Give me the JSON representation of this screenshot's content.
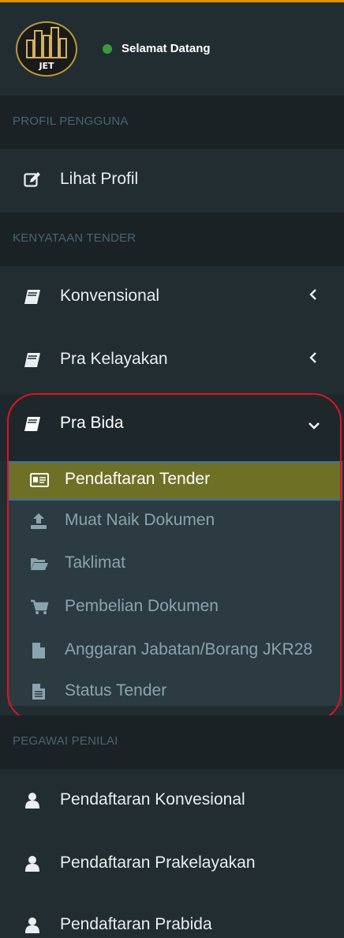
{
  "user": {
    "status_text": "Selamat Datang",
    "status_color": "#3c9a3a",
    "logo_text": "JET"
  },
  "headers": {
    "profile": "PROFIL PENGGUNA",
    "tender": "KENYATAAN TENDER",
    "evaluator": "PEGAWAI PENILAI"
  },
  "menu": {
    "lihat_profil": {
      "label": "Lihat Profil",
      "icon": "edit-icon"
    },
    "konvensional": {
      "label": "Konvensional",
      "icon": "book-icon"
    },
    "pra_kelayakan": {
      "label": "Pra Kelayakan",
      "icon": "book-icon"
    },
    "pra_bida": {
      "label": "Pra Bida",
      "icon": "book-icon"
    }
  },
  "submenu": [
    {
      "label": "Pendaftaran Tender",
      "icon": "id-card-icon",
      "selected": true
    },
    {
      "label": "Muat Naik Dokumen",
      "icon": "upload-icon"
    },
    {
      "label": "Taklimat",
      "icon": "folder-open-icon"
    },
    {
      "label": "Pembelian Dokumen",
      "icon": "cart-icon"
    },
    {
      "label": "Anggaran Jabatan/Borang JKR28",
      "icon": "file-icon"
    },
    {
      "label": "Status Tender",
      "icon": "file-text-icon"
    }
  ],
  "evaluator_menu": [
    {
      "label": "Pendaftaran Konvesional",
      "icon": "user-icon"
    },
    {
      "label": "Pendaftaran Prakelayakan",
      "icon": "user-icon"
    },
    {
      "label": "Pendaftaran Prabida",
      "icon": "user-icon"
    }
  ],
  "colors": {
    "sidebar_bg": "#222d32",
    "header_bg": "#1a2226",
    "submenu_bg": "#2c3b41",
    "selected_bg": "#6e7125",
    "highlight_outline": "#e0131a",
    "top_accent": "#e08e0b"
  }
}
